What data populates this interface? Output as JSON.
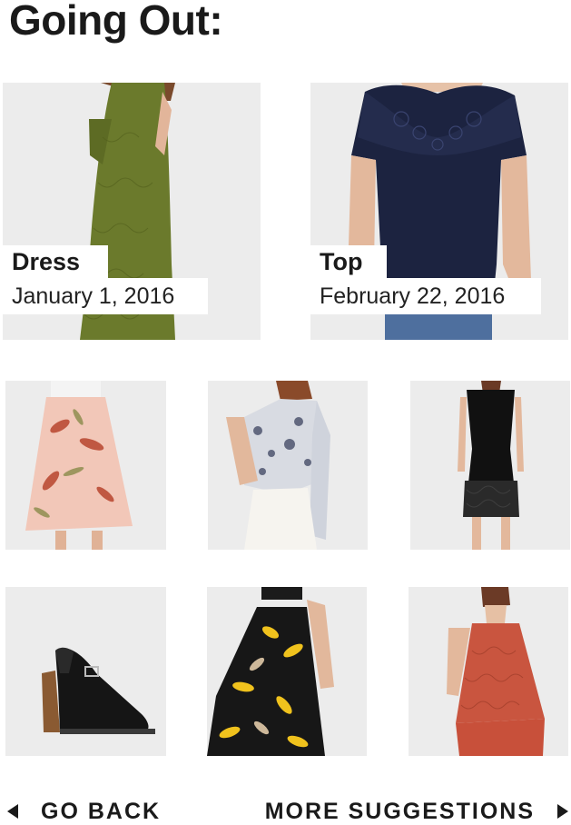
{
  "page": {
    "title": "Going Out:"
  },
  "featured": [
    {
      "category": "Dress",
      "date": "January 1, 2016",
      "image": "green lace dress"
    },
    {
      "category": "Top",
      "date": "February 22, 2016",
      "image": "navy lace top"
    }
  ],
  "suggestions": [
    {
      "image": "floral midi skirt"
    },
    {
      "image": "printed cropped jacket"
    },
    {
      "image": "black lace dress"
    },
    {
      "image": "block heel sandals"
    },
    {
      "image": "yellow floral skirt"
    },
    {
      "image": "coral lace top"
    }
  ],
  "nav": {
    "back_label": "GO BACK",
    "more_label": "MORE SUGGESTIONS"
  }
}
